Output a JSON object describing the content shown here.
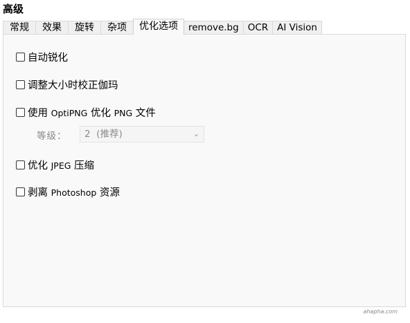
{
  "section_title": "高级",
  "tabs": [
    {
      "label": "常规",
      "active": false
    },
    {
      "label": "效果",
      "active": false
    },
    {
      "label": "旋转",
      "active": false
    },
    {
      "label": "杂项",
      "active": false
    },
    {
      "label": "优化选项",
      "active": true
    },
    {
      "label": "remove.bg",
      "active": false
    },
    {
      "label": "OCR",
      "active": false
    },
    {
      "label": "AI Vision",
      "active": false
    }
  ],
  "options": {
    "auto_sharpen": {
      "label": "自动锐化",
      "checked": false
    },
    "gamma_correct": {
      "label": "调整大小时校正伽玛",
      "checked": false
    },
    "optipng": {
      "label_a": "使用 ",
      "label_b": "OptiPNG",
      "label_c": " 优化 ",
      "label_d": "PNG",
      "label_e": " 文件",
      "checked": false
    },
    "optimize_jpeg": {
      "label_a": "优化 ",
      "label_b": "JPEG",
      "label_c": " 压缩",
      "checked": false
    },
    "strip_photoshop": {
      "label_a": "剥离 ",
      "label_b": "Photoshop",
      "label_c": " 资源",
      "checked": false
    }
  },
  "level": {
    "label": "等级：",
    "value": "2  (推荐)",
    "chevron_icon": "chevron-down-icon"
  },
  "watermark": "ahapha.com"
}
